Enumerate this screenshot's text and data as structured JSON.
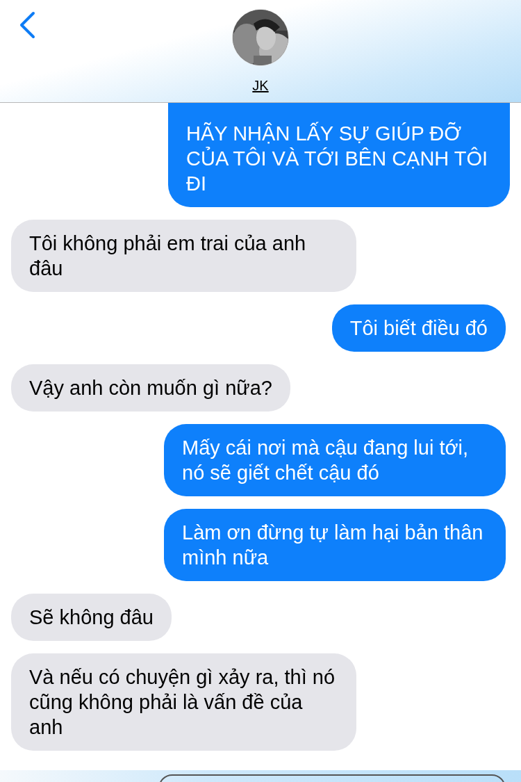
{
  "header": {
    "contact_name": "JK"
  },
  "messages": [
    {
      "kind": "sent",
      "text": "HÃY NHẬN LẤY SỰ GIÚP ĐỠ CỦA TÔI VÀ TỚI BÊN CẠNH TÔI ĐI"
    },
    {
      "kind": "received",
      "text": "Tôi không phải em trai của anh đâu"
    },
    {
      "kind": "sent",
      "text": "Tôi biết điều đó"
    },
    {
      "kind": "received",
      "text": "Vậy anh còn muốn gì nữa?"
    },
    {
      "kind": "sent",
      "text": "Mấy cái nơi mà cậu đang lui tới, nó sẽ giết chết cậu đó"
    },
    {
      "kind": "sent",
      "text": "Làm ơn đừng tự làm hại bản thân mình nữa"
    },
    {
      "kind": "received",
      "text": "Sẽ không đâu"
    },
    {
      "kind": "received",
      "text": "Và nếu có chuyện gì xảy ra, thì nó cũng không phải là vấn đề của anh"
    }
  ]
}
